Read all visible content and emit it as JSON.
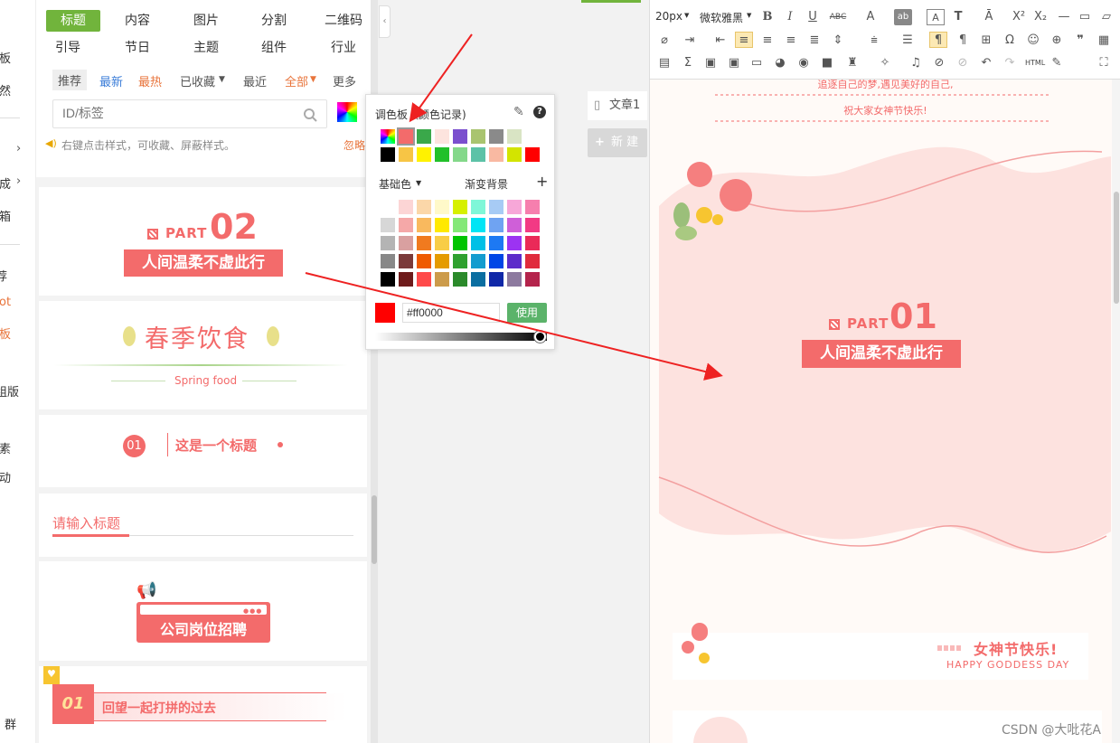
{
  "leftnav": {
    "items": [
      "板",
      "然",
      "成",
      "箱",
      "荐",
      "ot",
      "板",
      "组版",
      "素",
      "动",
      "群"
    ]
  },
  "panel": {
    "tabs_row1": [
      "标题",
      "内容",
      "图片",
      "分割",
      "二维码"
    ],
    "tabs_row2": [
      "引导",
      "节日",
      "主题",
      "组件",
      "行业"
    ],
    "filters": {
      "recommend": "推荐",
      "latest": "最新",
      "hottest": "最热",
      "collected": "已收藏",
      "recent": "最近",
      "all": "全部",
      "more": "更多"
    },
    "search": {
      "placeholder": "ID/标签"
    },
    "hint": "右键点击样式，可收藏、屏蔽样式。",
    "hint_link": "忽略",
    "cards": {
      "part_word": "PART",
      "part_num": "02",
      "part_title": "人间温柔不虚此行",
      "spring_title": "春季饮食",
      "spring_sub": "Spring food",
      "num_badge": "01",
      "num_title": "这是一个标题",
      "input_title": "请输入标题",
      "recruit": "公司岗位招聘",
      "review_num": "01",
      "review_title": "回望一起打拼的过去"
    }
  },
  "colors": {
    "accent_green": "#71b43c",
    "accent_red": "#f36b6b",
    "label_red": "#f47b7b",
    "orange": "#e8743b",
    "blue": "#3b7dd8",
    "arrow": "#ee2222"
  },
  "picker": {
    "title": "调色板（颜色记录)",
    "base_label": "基础色",
    "gradient_label": "渐变背景",
    "hex_value": "#ff0000",
    "use_button": "使用",
    "recent_colors": [
      "rainbow",
      "#f36b6b",
      "#3aa84a",
      "#fde4de",
      "#7a4fce",
      "#a9c46f",
      "#8a8a8a",
      "#d9e4c4",
      "#000000",
      "#f7c545",
      "#fff200",
      "#22c02a",
      "#84d88a",
      "#5cc2a7",
      "#f9b9a2",
      "#d3e400",
      "#ff0000"
    ],
    "base_colors": [
      [
        "#ffffff",
        "#fcd5d5",
        "#fbd7a9",
        "#fff9c9",
        "#d6f000",
        "#7ff7d8",
        "#a7cbf5",
        "#f7a7d8",
        "#f67fae"
      ],
      [
        "#d7d7d7",
        "#f5a8a8",
        "#f9b95e",
        "#ffe900",
        "#84e877",
        "#00e5f5",
        "#6fa3f2",
        "#cf5fd8",
        "#f23a84"
      ],
      [
        "#b4b4b4",
        "#d9a0a0",
        "#f07a1f",
        "#f8cd46",
        "#00c400",
        "#00c0e6",
        "#1d79f3",
        "#9c33f2",
        "#ea2a58"
      ],
      [
        "#888888",
        "#7b3a3a",
        "#ef5b00",
        "#e59b00",
        "#2fa12f",
        "#139ccf",
        "#0046e6",
        "#5d2cca",
        "#e02b3c"
      ],
      [
        "#000000",
        "#6e1b1b",
        "#ff4a4a",
        "#cc9b4a",
        "#2b8a2b",
        "#0b6ea1",
        "#1028a8",
        "#8d7a9f",
        "#b4244c"
      ]
    ]
  },
  "editor": {
    "font_size": "20px",
    "font_family": "微软雅黑",
    "html_label": "HTML",
    "canvas": {
      "top_line1": "追逐自己的梦,遇见美好的自己,",
      "top_line2": "祝大家女神节快乐!",
      "part_word": "PART",
      "part_num": "01",
      "part_title": "人间温柔不虚此行",
      "festival_title": "女神节快乐!",
      "festival_sub": "HAPPY GODDESS DAY"
    }
  },
  "middle": {
    "doc_label": "文章1",
    "new_button": "新 建"
  },
  "watermark": "CSDN @大吡花A"
}
